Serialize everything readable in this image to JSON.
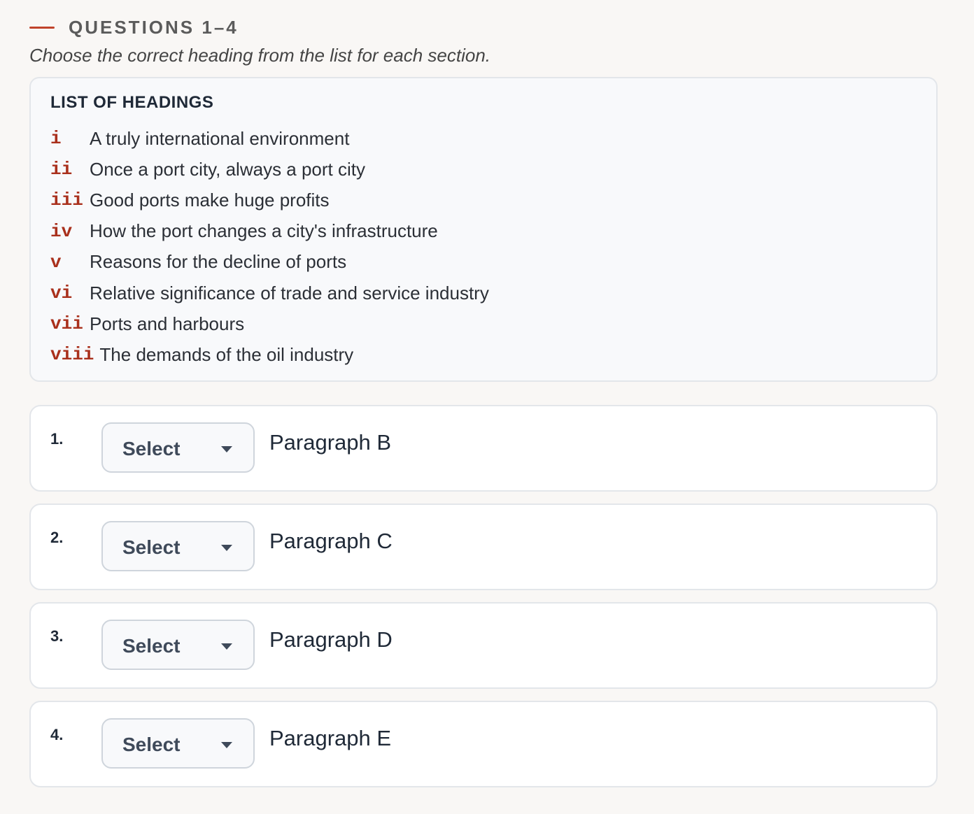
{
  "section": {
    "title": "QUESTIONS 1–4",
    "instruction": "Choose the correct heading from the list for each section.",
    "accent_color": "#c0432b"
  },
  "headings_box": {
    "title": "LIST OF HEADINGS",
    "items": [
      {
        "numeral": "i",
        "text": "A truly international environment"
      },
      {
        "numeral": "ii",
        "text": "Once a port city, always a port city"
      },
      {
        "numeral": "iii",
        "text": "Good ports make huge profits"
      },
      {
        "numeral": "iv",
        "text": "How the port changes a city's infrastructure"
      },
      {
        "numeral": "v",
        "text": "Reasons for the decline of ports"
      },
      {
        "numeral": "vi",
        "text": "Relative significance of trade and service industry"
      },
      {
        "numeral": "vii",
        "text": "Ports and harbours"
      },
      {
        "numeral": "viii",
        "text": "The demands of the oil industry"
      }
    ]
  },
  "questions": [
    {
      "number": "1.",
      "select_label": "Select",
      "paragraph": "Paragraph B"
    },
    {
      "number": "2.",
      "select_label": "Select",
      "paragraph": "Paragraph C"
    },
    {
      "number": "3.",
      "select_label": "Select",
      "paragraph": "Paragraph D"
    },
    {
      "number": "4.",
      "select_label": "Select",
      "paragraph": "Paragraph E"
    }
  ]
}
